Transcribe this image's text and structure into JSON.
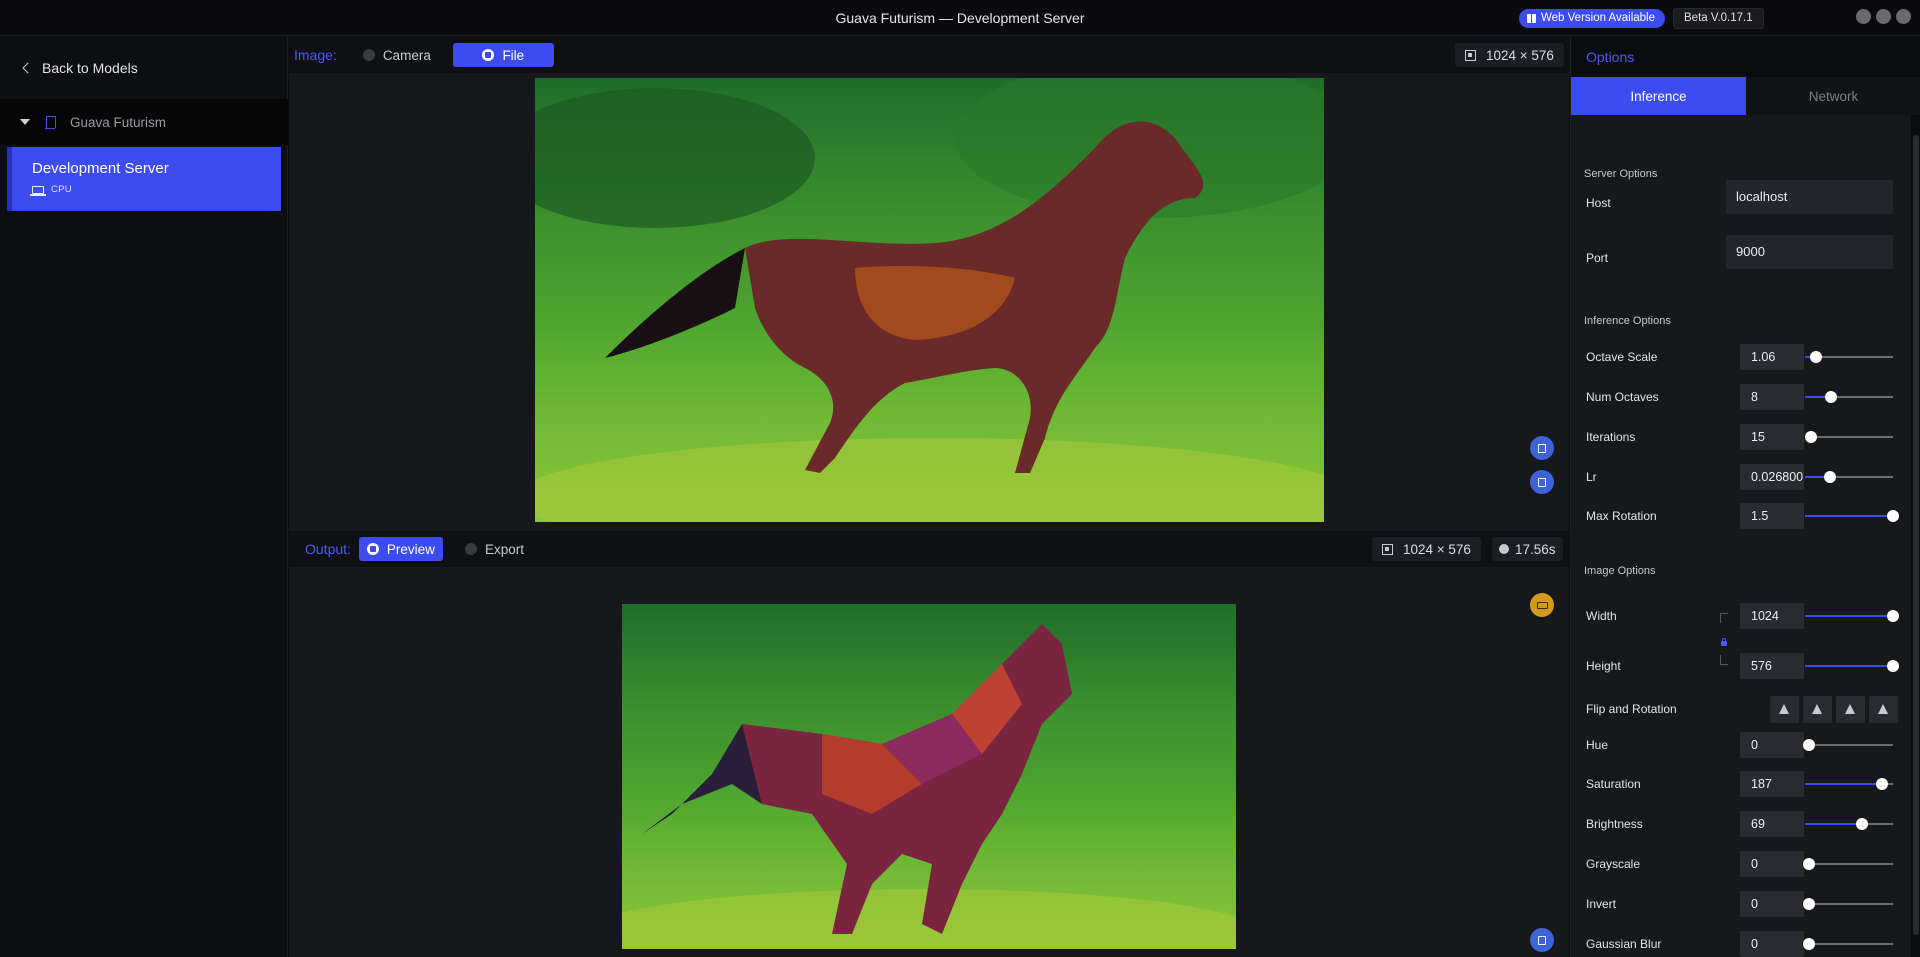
{
  "window": {
    "title": "Guava Futurism — Development Server",
    "web_badge": "Web Version Available",
    "version": "Beta V.0.17.1"
  },
  "sidebar": {
    "back_label": "Back to Models",
    "project_name": "Guava Futurism",
    "server": {
      "name": "Development Server",
      "device": "CPU"
    }
  },
  "input_bar": {
    "label": "Image:",
    "camera_label": "Camera",
    "file_label": "File",
    "size": "1024 × 576"
  },
  "output_bar": {
    "label": "Output:",
    "preview_label": "Preview",
    "export_label": "Export",
    "size": "1024 × 576",
    "time": "17.56s"
  },
  "options": {
    "title": "Options",
    "tabs": [
      "Inference",
      "Network"
    ],
    "server_section": "Server Options",
    "host_label": "Host",
    "host_value": "localhost",
    "port_label": "Port",
    "port_value": "9000",
    "inference_section": "Inference Options",
    "inference": [
      {
        "label": "Octave Scale",
        "value": "1.06",
        "level": 0.12
      },
      {
        "label": "Num Octaves",
        "value": "8",
        "level": 0.3
      },
      {
        "label": "Iterations",
        "value": "15",
        "level": 0.07
      },
      {
        "label": "Lr",
        "value": "0.026800",
        "level": 0.28
      },
      {
        "label": "Max Rotation",
        "value": "1.5",
        "level": 1.0
      }
    ],
    "image_section": "Image Options",
    "width_label": "Width",
    "width_value": "1024",
    "width_level": 1.0,
    "height_label": "Height",
    "height_value": "576",
    "height_level": 1.0,
    "flip_label": "Flip and Rotation",
    "adjustments": [
      {
        "label": "Hue",
        "value": "0",
        "level": 0.05
      },
      {
        "label": "Saturation",
        "value": "187",
        "level": 0.88
      },
      {
        "label": "Brightness",
        "value": "69",
        "level": 0.65
      },
      {
        "label": "Grayscale",
        "value": "0",
        "level": 0.05
      },
      {
        "label": "Invert",
        "value": "0",
        "level": 0.05
      },
      {
        "label": "Gaussian Blur",
        "value": "0",
        "level": 0.05
      }
    ]
  },
  "icons": {
    "back": "chevron-left-icon",
    "project": "bookmark-icon",
    "device": "laptop-icon",
    "camera": "camera-icon",
    "file": "file-icon",
    "size": "resize-icon",
    "time": "clock-icon",
    "preview": "eye-icon",
    "export": "download-icon"
  },
  "colors": {
    "accent": "#3d4cf0",
    "background": "#17181c",
    "sidebar": "#0d0e11"
  }
}
